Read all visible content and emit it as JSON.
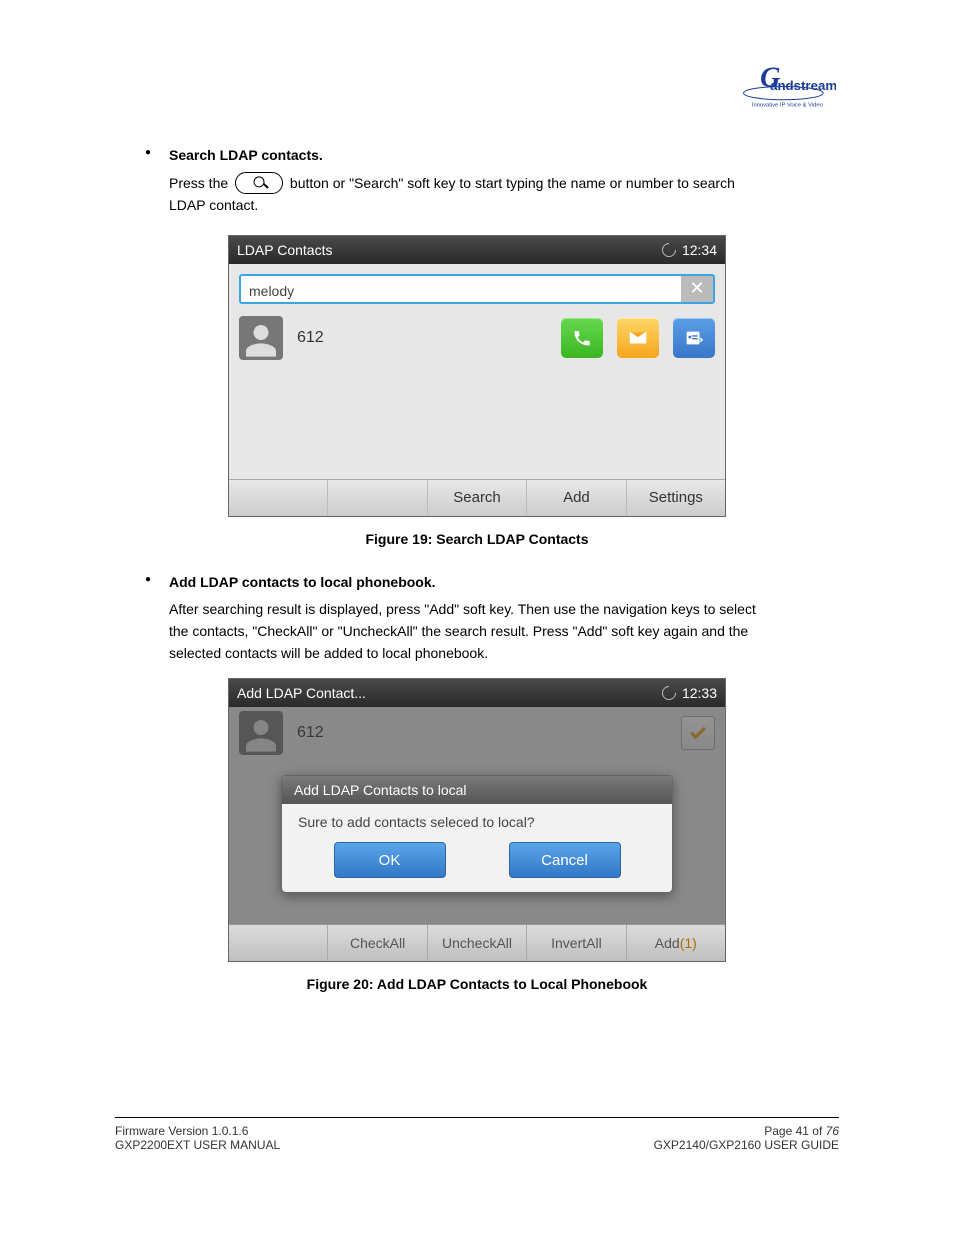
{
  "bullets": [
    {
      "title": "Search LDAP contacts.",
      "line1a": "Press the ",
      "line1b": " button or \"Search\" soft key to start typing the name or number to search",
      "line2": "LDAP contact."
    },
    {
      "title": "Add LDAP contacts to local phonebook.",
      "line1": "After searching result is displayed, press \"Add\" soft key. Then use the navigation keys to select",
      "line2": "the contacts, \"CheckAll\" or \"UncheckAll\" the search result. Press \"Add\" soft key again and the",
      "line3": "selected contacts will be added to local phonebook."
    }
  ],
  "screens": [
    {
      "title": "LDAP Contacts",
      "time": "12:34",
      "search_value": "melody",
      "contact_num": "612",
      "softkeys": [
        "Search",
        "Add",
        "Settings"
      ]
    },
    {
      "title": "Add LDAP Contact...",
      "time": "12:33",
      "contact_num": "612",
      "dialog": {
        "title": "Add LDAP Contacts to local",
        "body": "Sure to add contacts seleced to local?",
        "ok": "OK",
        "cancel": "Cancel"
      },
      "softkeys": [
        "CheckAll",
        "UncheckAll",
        "InvertAll",
        "Add"
      ],
      "add_count": "(1)"
    }
  ],
  "captions": [
    "Figure 19: Search LDAP Contacts",
    "Figure 20: Add LDAP Contacts to Local Phonebook"
  ],
  "footer": {
    "l1": "Firmware Version 1.0.1.6",
    "l2": "GXP2200EXT USER MANUAL",
    "r1a": "Page 41 of",
    "r1b": "76",
    "r2": "GXP2140/GXP2160 USER GUIDE"
  }
}
